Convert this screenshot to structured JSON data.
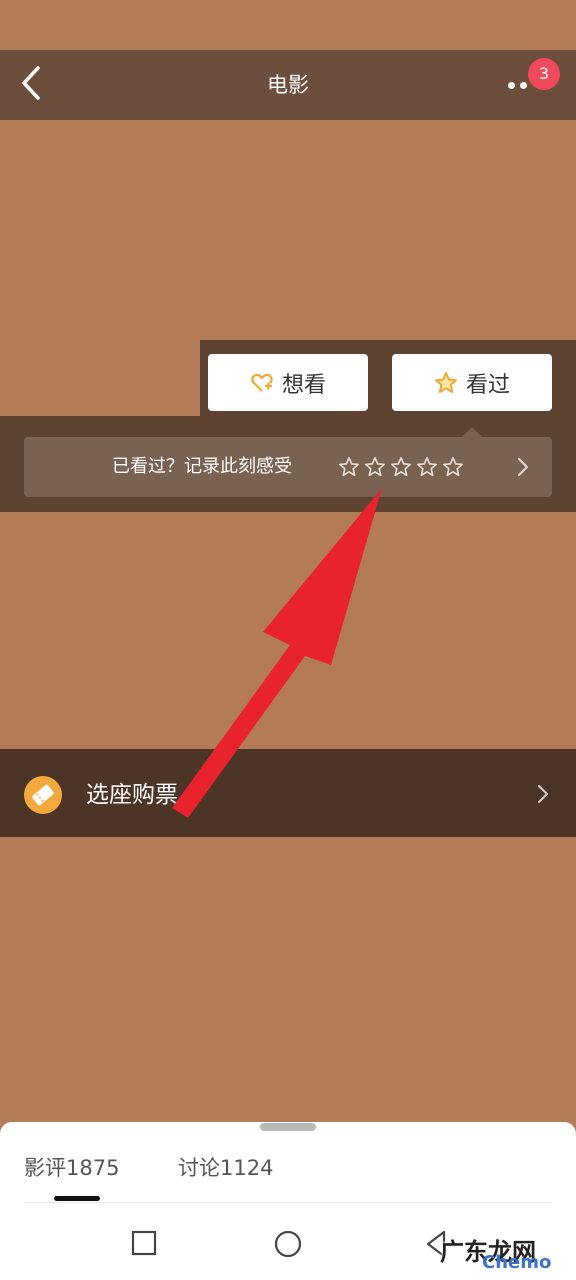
{
  "nav": {
    "title": "电影",
    "badge_count": "3"
  },
  "actions": {
    "want_label": "想看",
    "seen_label": "看过"
  },
  "rating": {
    "prompt": "已看过？记录此刻感受",
    "stars_total": 5
  },
  "ticket": {
    "label": "选座购票"
  },
  "sheet": {
    "tab_reviews": "影评1875",
    "tab_discussion": "讨论1124"
  },
  "watermark": {
    "text": "广东龙网",
    "sub": "Chemo"
  },
  "colors": {
    "background": "#b47c56",
    "nav_bar": "#6d4d3b",
    "panel": "#5f4331",
    "ticket_bar": "#4c3426",
    "accent_orange": "#f4a93c",
    "badge_red": "#f0495a",
    "arrow_red": "#e8232d"
  },
  "icons": {
    "back": "chevron-left-icon",
    "more": "more-dots-icon",
    "want": "heart-plus-icon",
    "seen": "star-outline-icon",
    "ticket": "ticket-icon"
  }
}
